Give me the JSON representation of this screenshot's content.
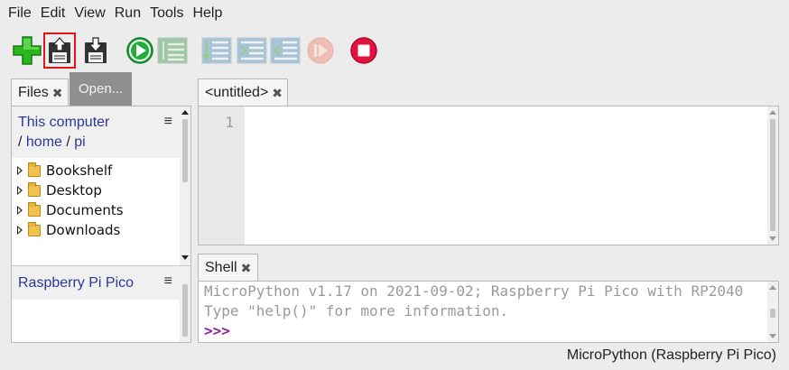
{
  "menu": [
    "File",
    "Edit",
    "View",
    "Run",
    "Tools",
    "Help"
  ],
  "toolbar": {
    "new": "new-file-icon",
    "open": "open-file-icon",
    "save": "save-file-icon",
    "run": "run-icon",
    "debug": "debug-icon",
    "step_over": "step-over-icon",
    "step_into": "step-into-icon",
    "step_out": "step-out-icon",
    "resume": "resume-icon",
    "stop": "stop-icon"
  },
  "tooltip": "Open...",
  "files": {
    "tab_label": "Files",
    "computer": {
      "title": "This computer",
      "path": [
        "home",
        "pi"
      ],
      "items": [
        "Bookshelf",
        "Desktop",
        "Documents",
        "Downloads"
      ]
    },
    "device": {
      "title": "Raspberry Pi Pico"
    }
  },
  "editor": {
    "tab_label": "<untitled>",
    "line_numbers": [
      "1"
    ]
  },
  "shell": {
    "tab_label": "Shell",
    "lines": [
      "MicroPython v1.17 on 2021-09-02; Raspberry Pi Pico with RP2040",
      "Type \"help()\" for more information."
    ],
    "prompt": ">>>"
  },
  "status": "MicroPython (Raspberry Pi Pico)",
  "colors": {
    "link": "#2b3796",
    "highlight": "#e0161b",
    "prompt": "#8b1fa0"
  }
}
